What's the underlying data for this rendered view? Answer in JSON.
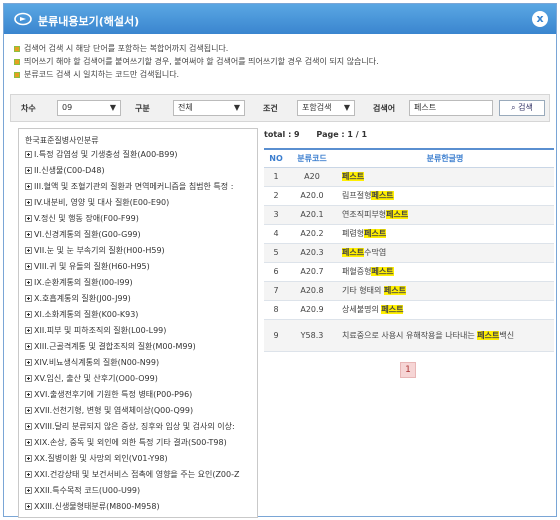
{
  "window": {
    "title": "분류내용보기(해설서)",
    "close_glyph": "x"
  },
  "notice": [
    "검색어 검색 시 해당 단어를 포함하는 복합어까지 검색됩니다.",
    "띄어쓰기 해야 할 검색어를 붙여쓰기할 경우, 붙여써야 할 검색어를 띄어쓰기할 경우 검색이 되지 않습니다.",
    "분류코드 검색 시 일치하는 코드만 검색됩니다."
  ],
  "search": {
    "version_label": "차수",
    "version_value": "09",
    "category_label": "구분",
    "category_value": "전체",
    "condition_label": "조건",
    "condition_value": "포함검색",
    "keyword_label": "검색어",
    "keyword_value": "페스트",
    "search_button": "검색"
  },
  "tree": {
    "root": "한국표준질병사인분류",
    "nodes": [
      "I.특정 감염성 및 기생충성 질환(A00-B99)",
      "II.신생물(C00-D48)",
      "III.혈액 및 조혈기관의 질환과 면역메커니즘을 침범한 특정 :",
      "IV.내분비, 영양 및 대사 질환(E00-E90)",
      "V.정신 및 행동 장애(F00-F99)",
      "VI.신경계통의 질환(G00-G99)",
      "VII.눈 및 눈 부속기의 질환(H00-H59)",
      "VIII.귀 및 유돌의 질환(H60-H95)",
      "IX.순환계통의 질환(I00-I99)",
      "X.호흡계통의 질환(J00-J99)",
      "XI.소화계통의 질환(K00-K93)",
      "XII.피부 및 피하조직의 질환(L00-L99)",
      "XIII.근골격계통 및 결합조직의 질환(M00-M99)",
      "XIV.비뇨생식계통의 질환(N00-N99)",
      "XV.임신, 출산 및 산후기(O00-O99)",
      "XVI.출생전후기에 기원한 특정 병태(P00-P96)",
      "XVII.선천기형, 변형 및 염색체이상(Q00-Q99)",
      "XVIII.달리 분류되지 않은 증상, 징후와 임상 및 검사의 이상:",
      "XIX.손상, 중독 및 외인에 의한 특정 기타 결과(S00-T98)",
      "XX.질병이환 및 사망의 외인(V01-Y98)",
      "XXI.건강상태 및 보건서비스 접촉에 영향을 주는 요인(Z00-Z",
      "XXII.특수목적 코드(U00-U99)",
      "XXIII.신생물형태분류(M800-M958)"
    ]
  },
  "results": {
    "total": "total : 9",
    "page": "Page : 1 / 1",
    "columns": [
      "NO",
      "분류코드",
      "분류한글명"
    ],
    "rows": [
      {
        "no": "1",
        "code": "A20",
        "pre": "",
        "hl": "페스트",
        "post": ""
      },
      {
        "no": "2",
        "code": "A20.0",
        "pre": "림프절형",
        "hl": "페스트",
        "post": ""
      },
      {
        "no": "3",
        "code": "A20.1",
        "pre": "연조직피부형",
        "hl": "페스트",
        "post": ""
      },
      {
        "no": "4",
        "code": "A20.2",
        "pre": "폐렴형",
        "hl": "페스트",
        "post": ""
      },
      {
        "no": "5",
        "code": "A20.3",
        "pre": "",
        "hl": "페스트",
        "post": "수막염"
      },
      {
        "no": "6",
        "code": "A20.7",
        "pre": "패혈증형",
        "hl": "페스트",
        "post": ""
      },
      {
        "no": "7",
        "code": "A20.8",
        "pre": "기타 형태의 ",
        "hl": "페스트",
        "post": ""
      },
      {
        "no": "8",
        "code": "A20.9",
        "pre": "상세불명의 ",
        "hl": "페스트",
        "post": ""
      },
      {
        "no": "9",
        "code": "Y58.3",
        "pre": "치료중으로 사용시 유해작용을 나타내는 ",
        "hl": "페스트",
        "post": "백신"
      }
    ],
    "pager_current": "1"
  }
}
